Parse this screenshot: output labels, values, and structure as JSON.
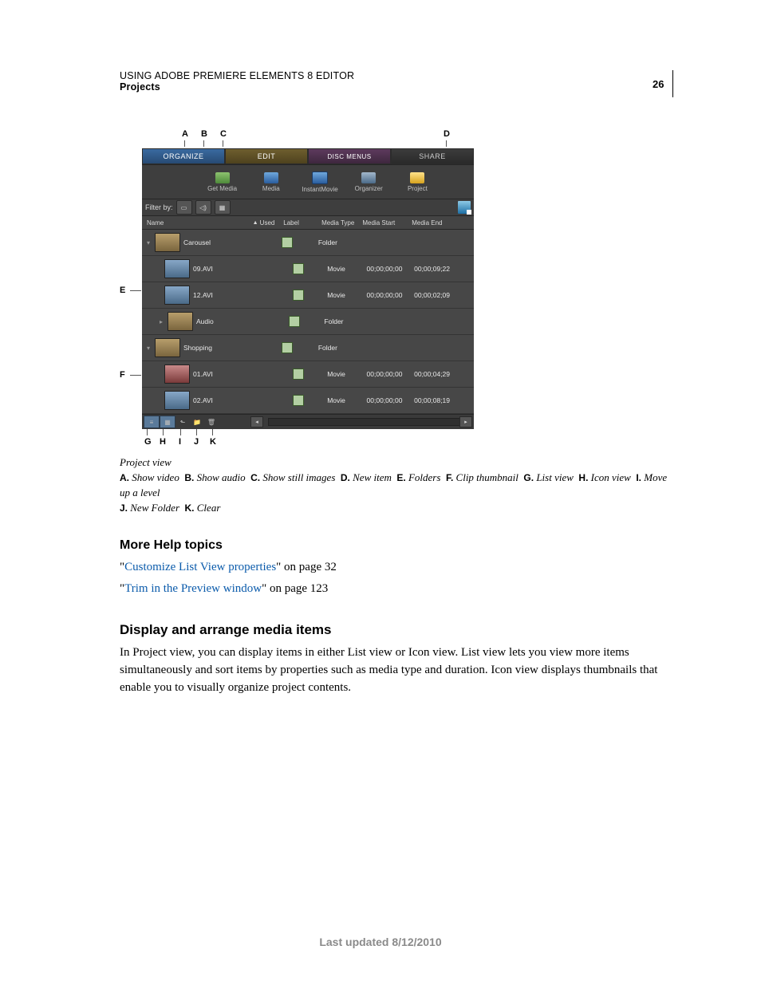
{
  "header": {
    "title": "USING ADOBE PREMIERE ELEMENTS 8 EDITOR",
    "section": "Projects",
    "page_number": "26"
  },
  "callouts": {
    "top": {
      "A": "A",
      "B": "B",
      "C": "C",
      "D": "D"
    },
    "side": {
      "E": "E",
      "F": "F"
    },
    "bottom": {
      "G": "G",
      "H": "H",
      "I": "I",
      "J": "J",
      "K": "K"
    }
  },
  "ui": {
    "tabs": {
      "organize": "ORGANIZE",
      "edit": "EDIT",
      "disc": "DISC MENUS",
      "share": "SHARE"
    },
    "toolbar": {
      "get_media": "Get Media",
      "media": "Media",
      "instant_movie": "InstantMovie",
      "organizer": "Organizer",
      "project": "Project"
    },
    "filter": {
      "label": "Filter by:"
    },
    "columns": {
      "name": "Name",
      "used": "Used",
      "label": "Label",
      "media_type": "Media Type",
      "media_start": "Media Start",
      "media_end": "Media End"
    },
    "rows": {
      "carousel": {
        "name": "Carousel",
        "type": "Folder"
      },
      "clip09": {
        "name": "09.AVI",
        "type": "Movie",
        "start": "00;00;00;00",
        "end": "00;00;09;22"
      },
      "clip12": {
        "name": "12.AVI",
        "type": "Movie",
        "start": "00;00;00;00",
        "end": "00;00;02;09"
      },
      "audio": {
        "name": "Audio",
        "type": "Folder"
      },
      "shopping": {
        "name": "Shopping",
        "type": "Folder"
      },
      "clip01": {
        "name": "01.AVI",
        "type": "Movie",
        "start": "00;00;00;00",
        "end": "00;00;04;29"
      },
      "clip02": {
        "name": "02.AVI",
        "type": "Movie",
        "start": "00;00;00;00",
        "end": "00;00;08;19"
      }
    }
  },
  "caption": "Project view",
  "legend": {
    "A": "Show video",
    "B": "Show audio",
    "C": "Show still images",
    "D": "New item",
    "E": "Folders",
    "F": "Clip thumbnail",
    "G": "List view",
    "H": "Icon view",
    "I": "Move up a level",
    "J": "New Folder",
    "K": "Clear"
  },
  "help": {
    "heading": "More Help topics",
    "link1": {
      "text": "Customize List View properties",
      "suffix": "\" on page 32"
    },
    "link2": {
      "text": "Trim in the Preview window",
      "suffix": "\" on page 123"
    },
    "quote": "\""
  },
  "section": {
    "heading": "Display and arrange media items",
    "body": "In Project view, you can display items in either List view or Icon view. List view lets you view more items simultaneously and sort items by properties such as media type and duration. Icon view displays thumbnails that enable you to visually organize project contents."
  },
  "footer": "Last updated 8/12/2010"
}
